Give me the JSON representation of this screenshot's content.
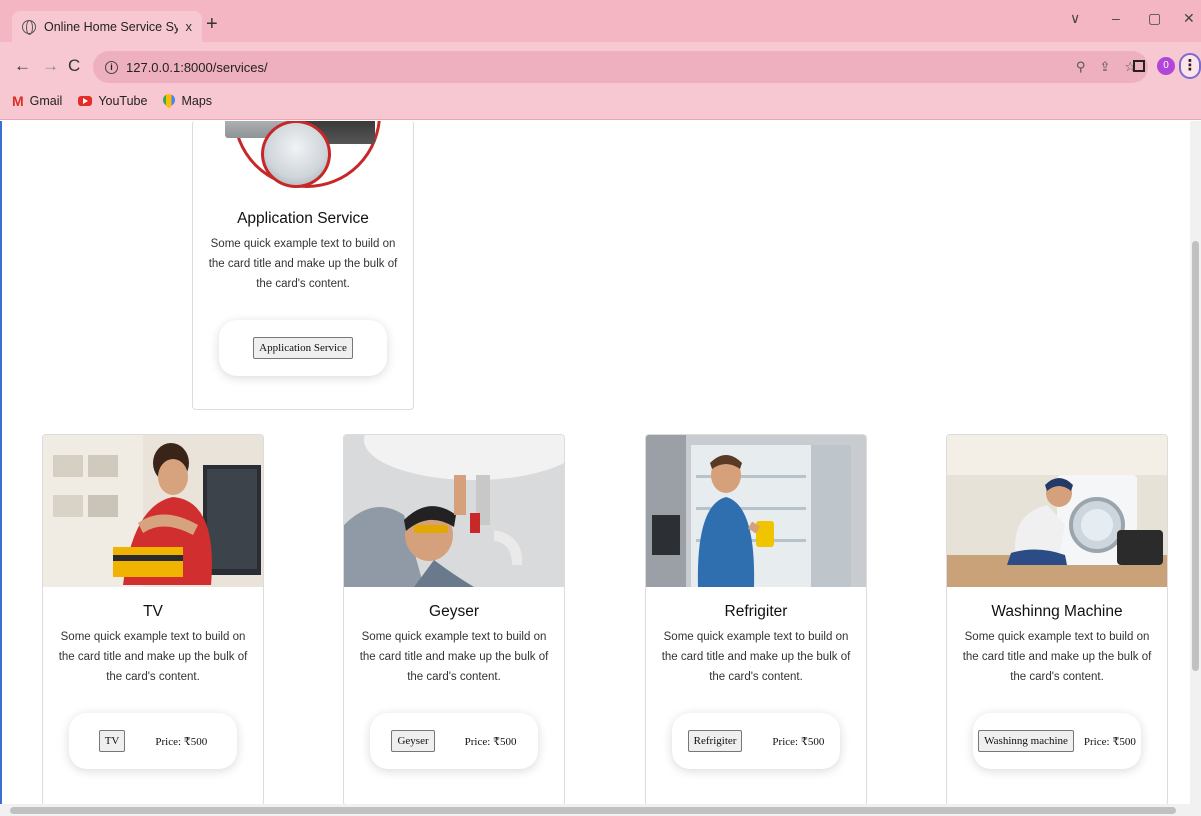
{
  "browser": {
    "tab_title": "Online Home Service System",
    "tab_close": "x",
    "new_tab": "+",
    "url": "127.0.0.1:8000/services/",
    "window_controls": [
      "∨",
      "–",
      "▢",
      "✕"
    ],
    "profile_initial": "0",
    "bookmarks": [
      {
        "label": "Gmail",
        "icon": "gmail-icon"
      },
      {
        "label": "YouTube",
        "icon": "youtube-icon"
      },
      {
        "label": "Maps",
        "icon": "maps-icon"
      }
    ]
  },
  "featured_card": {
    "title": "Application Service",
    "text": "Some quick example text to build on the card title and make up the bulk of the card's content.",
    "button": "Application Service"
  },
  "cards": [
    {
      "title": "TV",
      "text": "Some quick example text to build on the card title and make up the bulk of the card's content.",
      "button": "TV",
      "price": "Price: ₹500"
    },
    {
      "title": "Geyser",
      "text": "Some quick example text to build on the card title and make up the bulk of the card's content.",
      "button": "Geyser",
      "price": "Price: ₹500"
    },
    {
      "title": "Refrigiter",
      "text": "Some quick example text to build on the card title and make up the bulk of the card's content.",
      "button": "Refrigiter",
      "price": "Price: ₹500"
    },
    {
      "title": "Washinng Machine",
      "text": "Some quick example text to build on the card title and make up the bulk of the card's content.",
      "button": "Washinng machine",
      "price": "Price: ₹500"
    }
  ],
  "colors": {
    "chrome_bg": "#f8c8d2",
    "tabstrip_bg": "#f4b6c2",
    "accent_red": "#c62828"
  }
}
